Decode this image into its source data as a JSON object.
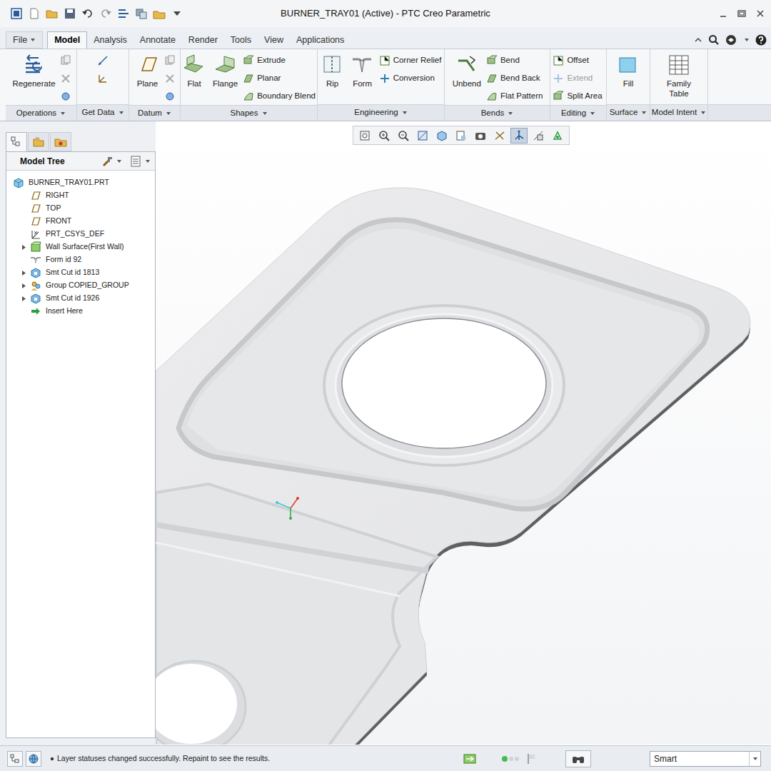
{
  "window": {
    "title": "BURNER_TRAY01 (Active) - PTC Creo Parametric"
  },
  "ribbon": {
    "tabs": [
      {
        "label": "File",
        "kind": "menu",
        "selected": false
      },
      {
        "label": "Model",
        "kind": "tab",
        "selected": true
      },
      {
        "label": "Analysis",
        "kind": "tab",
        "selected": false
      },
      {
        "label": "Annotate",
        "kind": "tab",
        "selected": false
      },
      {
        "label": "Render",
        "kind": "tab",
        "selected": false
      },
      {
        "label": "Tools",
        "kind": "tab",
        "selected": false
      },
      {
        "label": "View",
        "kind": "tab",
        "selected": false
      },
      {
        "label": "Applications",
        "kind": "tab",
        "selected": false
      }
    ],
    "groups": [
      {
        "label": "Operations",
        "items": [
          {
            "kind": "large",
            "label": "Regenerate",
            "disabled": false
          },
          {
            "kind": "icon",
            "disabled": false
          },
          {
            "kind": "icon",
            "disabled": false
          },
          {
            "kind": "icon",
            "disabled": false
          }
        ]
      },
      {
        "label": "Get Data",
        "items": [
          {
            "kind": "icon",
            "disabled": false
          },
          {
            "kind": "icon",
            "disabled": false
          }
        ]
      },
      {
        "label": "Datum",
        "items": [
          {
            "kind": "large",
            "label": "Plane",
            "disabled": false
          },
          {
            "kind": "icon",
            "disabled": false
          },
          {
            "kind": "icon",
            "disabled": false
          },
          {
            "kind": "icon",
            "disabled": false
          }
        ]
      },
      {
        "label": "Shapes",
        "items": [
          {
            "kind": "large",
            "label": "Flat",
            "disabled": false
          },
          {
            "kind": "large",
            "label": "Flange",
            "disabled": false
          },
          {
            "kind": "small",
            "label": "Extrude",
            "disabled": false
          },
          {
            "kind": "small",
            "label": "Planar",
            "disabled": false
          },
          {
            "kind": "small",
            "label": "Boundary Blend",
            "disabled": false
          }
        ]
      },
      {
        "label": "Engineering",
        "items": [
          {
            "kind": "large",
            "label": "Rip",
            "disabled": false
          },
          {
            "kind": "large",
            "label": "Form",
            "disabled": false
          },
          {
            "kind": "small",
            "label": "Corner Relief",
            "disabled": false
          },
          {
            "kind": "small",
            "label": "Conversion",
            "disabled": false
          }
        ]
      },
      {
        "label": "Bends",
        "items": [
          {
            "kind": "large",
            "label": "Unbend",
            "disabled": false
          },
          {
            "kind": "small",
            "label": "Bend",
            "disabled": false
          },
          {
            "kind": "small",
            "label": "Bend Back",
            "disabled": false
          },
          {
            "kind": "small",
            "label": "Flat Pattern",
            "disabled": false
          }
        ]
      },
      {
        "label": "Editing",
        "items": [
          {
            "kind": "small",
            "label": "Offset",
            "disabled": false
          },
          {
            "kind": "small",
            "label": "Extend",
            "disabled": true
          },
          {
            "kind": "small",
            "label": "Split Area",
            "disabled": false
          }
        ]
      },
      {
        "label": "Surface",
        "items": [
          {
            "kind": "large",
            "label": "Fill",
            "disabled": false
          }
        ]
      },
      {
        "label": "Model Intent",
        "items": [
          {
            "kind": "large",
            "label": "Family Table",
            "disabled": false
          }
        ]
      }
    ]
  },
  "model_tree": {
    "title": "Model Tree",
    "items": [
      {
        "label": "BURNER_TRAY01.PRT",
        "kind": "part",
        "expandable": false,
        "expanded": false
      },
      {
        "label": "RIGHT",
        "kind": "plane",
        "expandable": false,
        "expanded": false
      },
      {
        "label": "TOP",
        "kind": "plane",
        "expandable": false,
        "expanded": false
      },
      {
        "label": "FRONT",
        "kind": "plane",
        "expandable": false,
        "expanded": false
      },
      {
        "label": "PRT_CSYS_DEF",
        "kind": "csys",
        "expandable": false,
        "expanded": false
      },
      {
        "label": "Wall Surface(First Wall)",
        "kind": "surface",
        "expandable": true,
        "expanded": false
      },
      {
        "label": "Form id 92",
        "kind": "form",
        "expandable": false,
        "expanded": false
      },
      {
        "label": "Smt Cut id 1813",
        "kind": "cut",
        "expandable": true,
        "expanded": false
      },
      {
        "label": "Group COPIED_GROUP",
        "kind": "group",
        "expandable": true,
        "expanded": false
      },
      {
        "label": "Smt Cut id 1926",
        "kind": "cut",
        "expandable": true,
        "expanded": false
      },
      {
        "label": "Insert Here",
        "kind": "insert",
        "expandable": false,
        "expanded": false
      }
    ]
  },
  "status_bar": {
    "message": "Layer statuses changed successfully. Repaint to see the results.",
    "filter": "Smart"
  }
}
